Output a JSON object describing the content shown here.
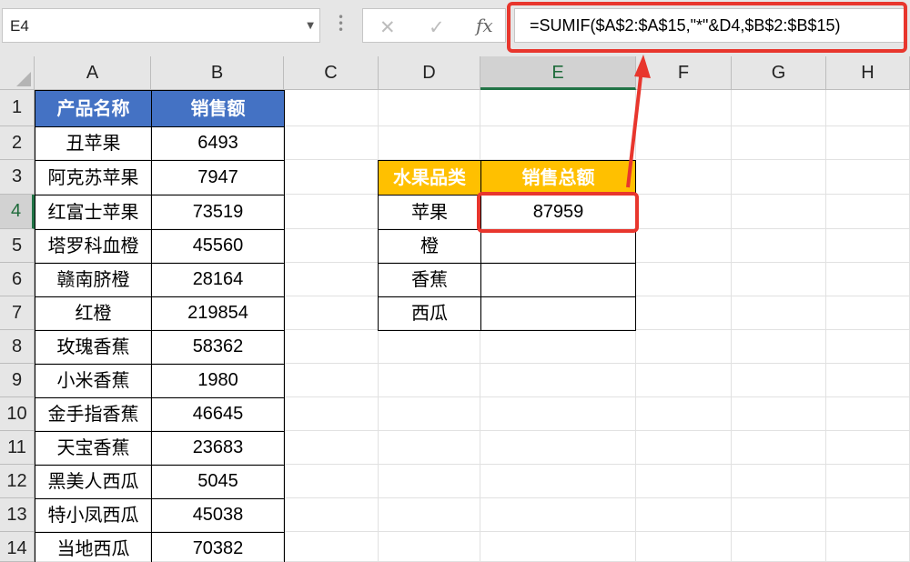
{
  "namebox": {
    "value": "E4"
  },
  "formula_bar": {
    "cancel_icon": "✕",
    "enter_icon": "✓",
    "fx_label": "fx",
    "formula": "=SUMIF($A$2:$A$15,\"*\"&D4,$B$2:$B$15)"
  },
  "columns": [
    "A",
    "B",
    "C",
    "D",
    "E",
    "F",
    "G",
    "H"
  ],
  "rows": [
    "1",
    "2",
    "3",
    "4",
    "5",
    "6",
    "7",
    "8",
    "9",
    "10",
    "11",
    "12",
    "13",
    "14"
  ],
  "table_products": {
    "header_name": "产品名称",
    "header_sales": "销售额",
    "items": [
      {
        "name": "丑苹果",
        "sales": "6493"
      },
      {
        "name": "阿克苏苹果",
        "sales": "7947"
      },
      {
        "name": "红富士苹果",
        "sales": "73519"
      },
      {
        "name": "塔罗科血橙",
        "sales": "45560"
      },
      {
        "name": "赣南脐橙",
        "sales": "28164"
      },
      {
        "name": "红橙",
        "sales": "219854"
      },
      {
        "name": "玫瑰香蕉",
        "sales": "58362"
      },
      {
        "name": "小米香蕉",
        "sales": "1980"
      },
      {
        "name": "金手指香蕉",
        "sales": "46645"
      },
      {
        "name": "天宝香蕉",
        "sales": "23683"
      },
      {
        "name": "黑美人西瓜",
        "sales": "5045"
      },
      {
        "name": "特小凤西瓜",
        "sales": "45038"
      },
      {
        "name": "当地西瓜",
        "sales": "70382"
      }
    ]
  },
  "table_summary": {
    "header_category": "水果品类",
    "header_total": "销售总额",
    "items": [
      {
        "category": "苹果",
        "total": "87959"
      },
      {
        "category": "橙",
        "total": ""
      },
      {
        "category": "香蕉",
        "total": ""
      },
      {
        "category": "西瓜",
        "total": ""
      }
    ]
  },
  "colors": {
    "header_blue": "#4472c4",
    "header_gold": "#ffc000",
    "highlight_red": "#e8362d",
    "selection_green": "#217346"
  },
  "icons": [
    "dropdown-arrow-icon",
    "cancel-icon",
    "enter-check-icon",
    "function-icon",
    "select-all-icon",
    "annotation-arrow-icon"
  ]
}
